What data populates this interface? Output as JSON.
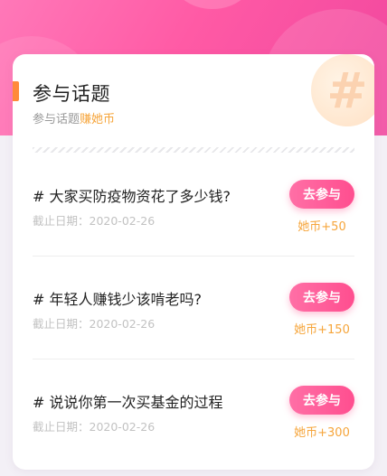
{
  "card": {
    "title": "参与话题",
    "subtitle_prefix": "参与话题",
    "subtitle_highlight": "赚她币",
    "deco_icon": "hash-icon",
    "deco_glyph": "#"
  },
  "topics": [
    {
      "title": "# 大家买防疫物资花了多少钱?",
      "deadline": "截止日期：2020-02-26",
      "button": "去参与",
      "reward": "她币+50"
    },
    {
      "title": "# 年轻人赚钱少该啃老吗?",
      "deadline": "截止日期：2020-02-26",
      "button": "去参与",
      "reward": "她币+150"
    },
    {
      "title": "# 说说你第一次买基金的过程",
      "deadline": "截止日期：2020-02-26",
      "button": "去参与",
      "reward": "她币+300"
    }
  ],
  "colors": {
    "accent_pink": "#ff4e8f",
    "accent_orange": "#f6a53b",
    "accent_bar": "#ff8a3a"
  }
}
